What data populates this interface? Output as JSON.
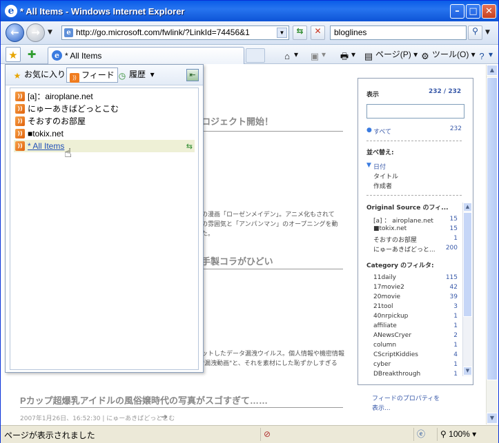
{
  "window": {
    "title": "* All Items - Windows Internet Explorer"
  },
  "address": {
    "url": "http://go.microsoft.com/fwlink/?LinkId=74456&1",
    "search_value": "bloglines"
  },
  "tab": {
    "label": "* All Items"
  },
  "commands": {
    "page": "ページ(P)",
    "tools": "ツール(O)"
  },
  "favorites_center": {
    "tabs": [
      {
        "label": "お気に入り"
      },
      {
        "label": "フィード"
      },
      {
        "label": "履歴"
      }
    ],
    "feeds": [
      {
        "label": "[a]：airoplane.net"
      },
      {
        "label": "にゅーあきばどっとこむ"
      },
      {
        "label": "そおすのお部屋"
      },
      {
        "label": "■tokix.net"
      },
      {
        "label": "* All Items"
      }
    ]
  },
  "articles": [
    {
      "title": "ロジェクト開始！"
    },
    {
      "snippet1": "の漫画「ローゼンメイデン」。アニメ化もされて",
      "snippet2": "の雰囲気と「アンパンマン」のオープニングを動",
      "snippet3": "た。"
    },
    {
      "title": "手製コラがひどい"
    },
    {
      "snippet1": "ットしたデータ漏洩ウイルス。個人情報や機密情報",
      "snippet2": "\"漏洩動画\"と、それを素材にした恥ずかしすぎる"
    },
    {
      "title": "Pカップ超爆乳アイドルの風俗嬢時代の写真がスゴすぎて……",
      "meta": "2007年1月26日、16:52:30 | にゅーあきばどっとこむ"
    }
  ],
  "filter_panel": {
    "display_label": "表示",
    "count": "232 / 232",
    "all_label": "すべて",
    "all_count": "232",
    "sort_label": "並べ替え:",
    "sort_options": [
      "日付",
      "タイトル",
      "作成者"
    ],
    "source_header": "Original Source のフィ...",
    "sources": [
      {
        "name": "[a] ： airoplane.net",
        "count": "15"
      },
      {
        "name": "■tokix.net",
        "count": "15"
      },
      {
        "name": "そおすのお部屋",
        "count": "1"
      },
      {
        "name": "にゅーあきばどっと...",
        "count": "200"
      }
    ],
    "category_header": "Category のフィルタ:",
    "categories": [
      {
        "name": "11daily",
        "count": "115"
      },
      {
        "name": "17movie2",
        "count": "42"
      },
      {
        "name": "20movie",
        "count": "39"
      },
      {
        "name": "21tool",
        "count": "3"
      },
      {
        "name": "40nrpickup",
        "count": "1"
      },
      {
        "name": "affiliate",
        "count": "1"
      },
      {
        "name": "ANewsCryer",
        "count": "2"
      },
      {
        "name": "column",
        "count": "1"
      },
      {
        "name": "CScriptKiddies",
        "count": "4"
      },
      {
        "name": "cyber",
        "count": "1"
      },
      {
        "name": "DBreakthrough",
        "count": "1"
      }
    ],
    "feed_props_line1": "フィードのプロパティを",
    "feed_props_line2": "表示..."
  },
  "status": {
    "text": "ページが表示されました",
    "zoom": "100%"
  }
}
